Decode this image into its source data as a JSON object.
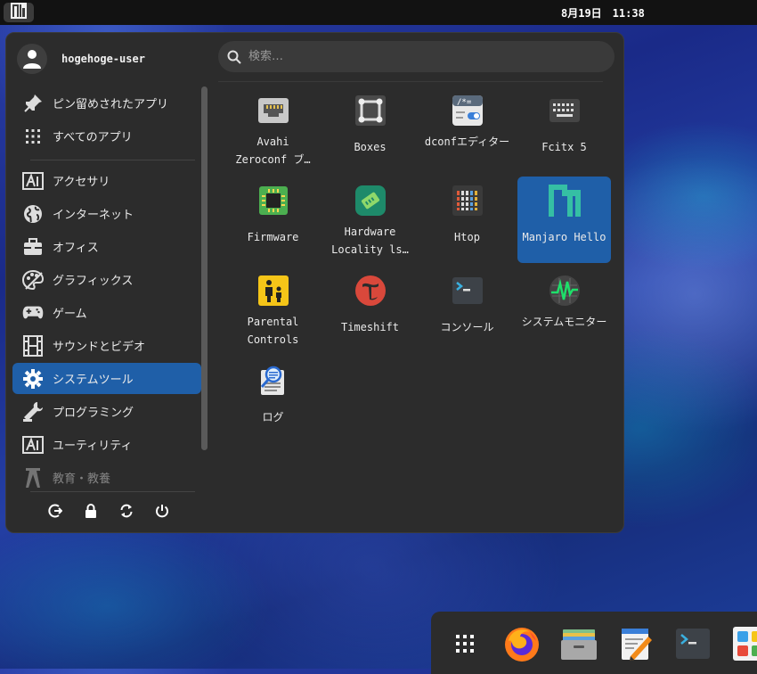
{
  "panel": {
    "clock": "8月19日　11:38",
    "logo_icon": "manjaro-logo-icon"
  },
  "menu": {
    "user": {
      "name": "hogehoge-user"
    },
    "search": {
      "placeholder": "検索…",
      "value": ""
    },
    "categories": [
      {
        "label": "ピン留めされたアプリ",
        "icon": "pin-icon"
      },
      {
        "label": "すべてのアプリ",
        "icon": "grid-dots-icon"
      },
      {
        "label": "アクセサリ",
        "icon": "accessories-icon"
      },
      {
        "label": "インターネット",
        "icon": "globe-icon"
      },
      {
        "label": "オフィス",
        "icon": "briefcase-icon"
      },
      {
        "label": "グラフィックス",
        "icon": "palette-icon"
      },
      {
        "label": "ゲーム",
        "icon": "gamepad-icon"
      },
      {
        "label": "サウンドとビデオ",
        "icon": "film-strip-icon"
      },
      {
        "label": "システムツール",
        "icon": "gear-icon",
        "selected": true
      },
      {
        "label": "プログラミング",
        "icon": "wrench-icon"
      },
      {
        "label": "ユーティリティ",
        "icon": "utilities-icon"
      },
      {
        "label": "教育・教養",
        "icon": "education-icon",
        "disabled": true
      }
    ],
    "apps": [
      {
        "label": "Avahi Zeroconf ブ…",
        "icon": "network-port-icon"
      },
      {
        "label": "Boxes",
        "icon": "boxes-icon"
      },
      {
        "label": "dconfエディター",
        "icon": "dconf-editor-icon"
      },
      {
        "label": "Fcitx 5",
        "icon": "keyboard-icon"
      },
      {
        "label": "Firmware",
        "icon": "chip-icon"
      },
      {
        "label": "Hardware Locality ls…",
        "icon": "hwloc-icon"
      },
      {
        "label": "Htop",
        "icon": "htop-icon"
      },
      {
        "label": "Manjaro Hello",
        "icon": "manjaro-logo-icon",
        "selected": true
      },
      {
        "label": "Parental Controls",
        "icon": "parental-controls-icon"
      },
      {
        "label": "Timeshift",
        "icon": "timeshift-icon"
      },
      {
        "label": "コンソール",
        "icon": "terminal-icon"
      },
      {
        "label": "システムモニター",
        "icon": "system-monitor-icon"
      },
      {
        "label": "ログ",
        "icon": "logs-icon"
      }
    ],
    "actions": [
      "logout-icon",
      "lock-icon",
      "restart-icon",
      "power-icon"
    ]
  },
  "dock": {
    "items": [
      "app-grid-icon",
      "firefox-icon",
      "files-icon",
      "text-editor-icon",
      "terminal-icon",
      "software-icon"
    ]
  },
  "colors": {
    "accent": "#1f5fa8",
    "menu_bg": "#2c2c2c"
  }
}
